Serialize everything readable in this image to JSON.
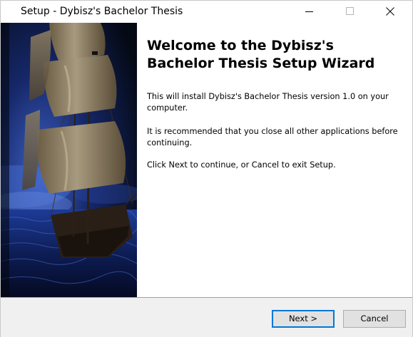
{
  "window": {
    "title": "Setup - Dybisz's Bachelor Thesis"
  },
  "content": {
    "heading": "Welcome to the Dybisz's Bachelor Thesis Setup Wizard",
    "paragraph_1": "This will install Dybisz's Bachelor Thesis version 1.0 on your computer.",
    "paragraph_2": "It is recommended that you close all other applications before continuing.",
    "paragraph_3": "Click Next to continue, or Cancel to exit Setup."
  },
  "buttons": {
    "next_label": "Next >",
    "cancel_label": "Cancel"
  },
  "icons": {
    "minimize": "minimize-icon",
    "maximize": "maximize-icon",
    "close": "close-icon"
  },
  "colors": {
    "accent": "#0078d7",
    "bottom_bar": "#f0f0f0"
  }
}
